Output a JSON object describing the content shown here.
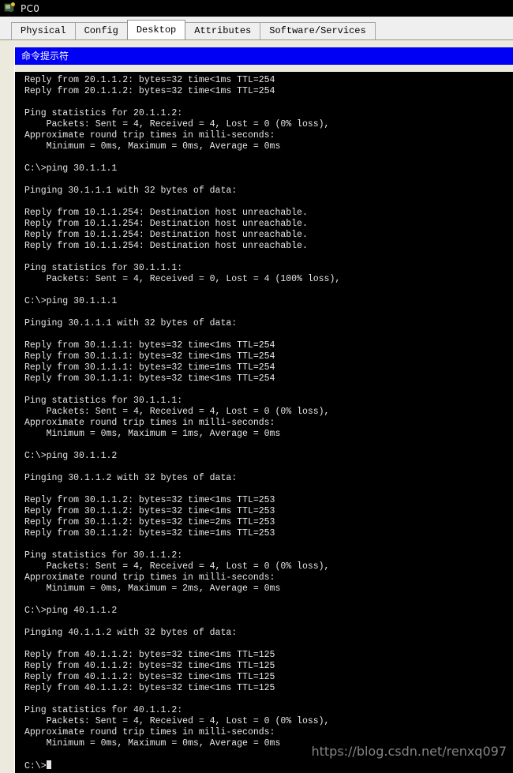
{
  "window": {
    "title": "PC0",
    "icon": "pc-device-icon"
  },
  "tabs": [
    {
      "label": "Physical",
      "active": false
    },
    {
      "label": "Config",
      "active": false
    },
    {
      "label": "Desktop",
      "active": true
    },
    {
      "label": "Attributes",
      "active": false
    },
    {
      "label": "Software/Services",
      "active": false
    }
  ],
  "command_prompt": {
    "title": "命令提示符",
    "prompt": "C:\\>",
    "lines": [
      "Reply from 20.1.1.2: bytes=32 time<1ms TTL=254",
      "Reply from 20.1.1.2: bytes=32 time<1ms TTL=254",
      "",
      "Ping statistics for 20.1.1.2:",
      "    Packets: Sent = 4, Received = 4, Lost = 0 (0% loss),",
      "Approximate round trip times in milli-seconds:",
      "    Minimum = 0ms, Maximum = 0ms, Average = 0ms",
      "",
      "C:\\>ping 30.1.1.1",
      "",
      "Pinging 30.1.1.1 with 32 bytes of data:",
      "",
      "Reply from 10.1.1.254: Destination host unreachable.",
      "Reply from 10.1.1.254: Destination host unreachable.",
      "Reply from 10.1.1.254: Destination host unreachable.",
      "Reply from 10.1.1.254: Destination host unreachable.",
      "",
      "Ping statistics for 30.1.1.1:",
      "    Packets: Sent = 4, Received = 0, Lost = 4 (100% loss),",
      "",
      "C:\\>ping 30.1.1.1",
      "",
      "Pinging 30.1.1.1 with 32 bytes of data:",
      "",
      "Reply from 30.1.1.1: bytes=32 time<1ms TTL=254",
      "Reply from 30.1.1.1: bytes=32 time<1ms TTL=254",
      "Reply from 30.1.1.1: bytes=32 time=1ms TTL=254",
      "Reply from 30.1.1.1: bytes=32 time<1ms TTL=254",
      "",
      "Ping statistics for 30.1.1.1:",
      "    Packets: Sent = 4, Received = 4, Lost = 0 (0% loss),",
      "Approximate round trip times in milli-seconds:",
      "    Minimum = 0ms, Maximum = 1ms, Average = 0ms",
      "",
      "C:\\>ping 30.1.1.2",
      "",
      "Pinging 30.1.1.2 with 32 bytes of data:",
      "",
      "Reply from 30.1.1.2: bytes=32 time<1ms TTL=253",
      "Reply from 30.1.1.2: bytes=32 time<1ms TTL=253",
      "Reply from 30.1.1.2: bytes=32 time=2ms TTL=253",
      "Reply from 30.1.1.2: bytes=32 time=1ms TTL=253",
      "",
      "Ping statistics for 30.1.1.2:",
      "    Packets: Sent = 4, Received = 4, Lost = 0 (0% loss),",
      "Approximate round trip times in milli-seconds:",
      "    Minimum = 0ms, Maximum = 2ms, Average = 0ms",
      "",
      "C:\\>ping 40.1.1.2",
      "",
      "Pinging 40.1.1.2 with 32 bytes of data:",
      "",
      "Reply from 40.1.1.2: bytes=32 time<1ms TTL=125",
      "Reply from 40.1.1.2: bytes=32 time<1ms TTL=125",
      "Reply from 40.1.1.2: bytes=32 time<1ms TTL=125",
      "Reply from 40.1.1.2: bytes=32 time<1ms TTL=125",
      "",
      "Ping statistics for 40.1.1.2:",
      "    Packets: Sent = 4, Received = 4, Lost = 0 (0% loss),",
      "Approximate round trip times in milli-seconds:",
      "    Minimum = 0ms, Maximum = 0ms, Average = 0ms",
      ""
    ]
  },
  "watermark": {
    "text": "https://blog.csdn.net/renxq097"
  },
  "colors": {
    "titlebar_bg": "#000000",
    "tabstrip_bg": "#efefef",
    "panel_bg": "#ece9dd",
    "cmd_titlebar_bg": "#0000f5",
    "terminal_bg": "#000000",
    "terminal_fg": "#e6e6e6"
  }
}
